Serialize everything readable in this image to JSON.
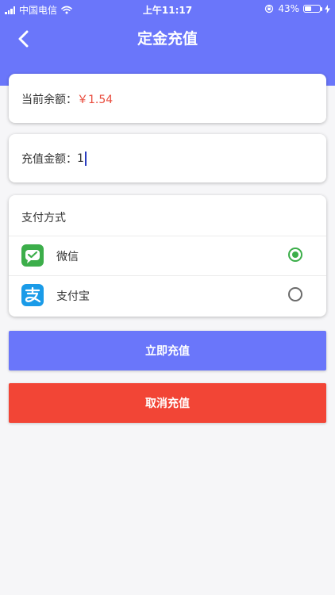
{
  "status_bar": {
    "carrier": "中国电信",
    "time": "上午11:17",
    "battery_percent": "43%",
    "battery_level": 0.43
  },
  "header": {
    "title": "定金充值",
    "back_icon": "chevron-left-icon",
    "color": "#6a76fa"
  },
  "balance": {
    "label": "当前余额：",
    "value": "￥1.54",
    "value_color": "#e94b3c"
  },
  "recharge": {
    "label": "充值金额：",
    "value": "1"
  },
  "payment": {
    "title": "支付方式",
    "options": [
      {
        "label": "微信",
        "icon": "wechat-pay-icon",
        "selected": true,
        "color": "#3cae4a"
      },
      {
        "label": "支付宝",
        "icon": "alipay-icon",
        "selected": false,
        "color": "#1a9be8"
      }
    ]
  },
  "actions": {
    "confirm_label": "立即充值",
    "confirm_color": "#6a76fa",
    "cancel_label": "取消充值",
    "cancel_color": "#f24536"
  }
}
